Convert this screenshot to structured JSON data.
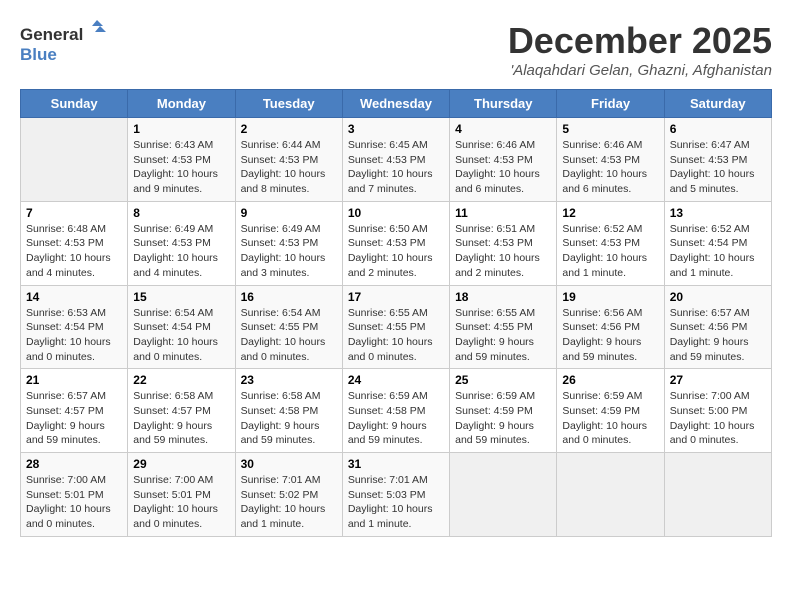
{
  "header": {
    "logo_line1": "General",
    "logo_line2": "Blue",
    "month_title": "December 2025",
    "location": "'Alaqahdari Gelan, Ghazni, Afghanistan"
  },
  "days_of_week": [
    "Sunday",
    "Monday",
    "Tuesday",
    "Wednesday",
    "Thursday",
    "Friday",
    "Saturday"
  ],
  "weeks": [
    [
      {
        "day": "",
        "info": ""
      },
      {
        "day": "1",
        "info": "Sunrise: 6:43 AM\nSunset: 4:53 PM\nDaylight: 10 hours\nand 9 minutes."
      },
      {
        "day": "2",
        "info": "Sunrise: 6:44 AM\nSunset: 4:53 PM\nDaylight: 10 hours\nand 8 minutes."
      },
      {
        "day": "3",
        "info": "Sunrise: 6:45 AM\nSunset: 4:53 PM\nDaylight: 10 hours\nand 7 minutes."
      },
      {
        "day": "4",
        "info": "Sunrise: 6:46 AM\nSunset: 4:53 PM\nDaylight: 10 hours\nand 6 minutes."
      },
      {
        "day": "5",
        "info": "Sunrise: 6:46 AM\nSunset: 4:53 PM\nDaylight: 10 hours\nand 6 minutes."
      },
      {
        "day": "6",
        "info": "Sunrise: 6:47 AM\nSunset: 4:53 PM\nDaylight: 10 hours\nand 5 minutes."
      }
    ],
    [
      {
        "day": "7",
        "info": "Sunrise: 6:48 AM\nSunset: 4:53 PM\nDaylight: 10 hours\nand 4 minutes."
      },
      {
        "day": "8",
        "info": "Sunrise: 6:49 AM\nSunset: 4:53 PM\nDaylight: 10 hours\nand 4 minutes."
      },
      {
        "day": "9",
        "info": "Sunrise: 6:49 AM\nSunset: 4:53 PM\nDaylight: 10 hours\nand 3 minutes."
      },
      {
        "day": "10",
        "info": "Sunrise: 6:50 AM\nSunset: 4:53 PM\nDaylight: 10 hours\nand 2 minutes."
      },
      {
        "day": "11",
        "info": "Sunrise: 6:51 AM\nSunset: 4:53 PM\nDaylight: 10 hours\nand 2 minutes."
      },
      {
        "day": "12",
        "info": "Sunrise: 6:52 AM\nSunset: 4:53 PM\nDaylight: 10 hours\nand 1 minute."
      },
      {
        "day": "13",
        "info": "Sunrise: 6:52 AM\nSunset: 4:54 PM\nDaylight: 10 hours\nand 1 minute."
      }
    ],
    [
      {
        "day": "14",
        "info": "Sunrise: 6:53 AM\nSunset: 4:54 PM\nDaylight: 10 hours\nand 0 minutes."
      },
      {
        "day": "15",
        "info": "Sunrise: 6:54 AM\nSunset: 4:54 PM\nDaylight: 10 hours\nand 0 minutes."
      },
      {
        "day": "16",
        "info": "Sunrise: 6:54 AM\nSunset: 4:55 PM\nDaylight: 10 hours\nand 0 minutes."
      },
      {
        "day": "17",
        "info": "Sunrise: 6:55 AM\nSunset: 4:55 PM\nDaylight: 10 hours\nand 0 minutes."
      },
      {
        "day": "18",
        "info": "Sunrise: 6:55 AM\nSunset: 4:55 PM\nDaylight: 9 hours\nand 59 minutes."
      },
      {
        "day": "19",
        "info": "Sunrise: 6:56 AM\nSunset: 4:56 PM\nDaylight: 9 hours\nand 59 minutes."
      },
      {
        "day": "20",
        "info": "Sunrise: 6:57 AM\nSunset: 4:56 PM\nDaylight: 9 hours\nand 59 minutes."
      }
    ],
    [
      {
        "day": "21",
        "info": "Sunrise: 6:57 AM\nSunset: 4:57 PM\nDaylight: 9 hours\nand 59 minutes."
      },
      {
        "day": "22",
        "info": "Sunrise: 6:58 AM\nSunset: 4:57 PM\nDaylight: 9 hours\nand 59 minutes."
      },
      {
        "day": "23",
        "info": "Sunrise: 6:58 AM\nSunset: 4:58 PM\nDaylight: 9 hours\nand 59 minutes."
      },
      {
        "day": "24",
        "info": "Sunrise: 6:59 AM\nSunset: 4:58 PM\nDaylight: 9 hours\nand 59 minutes."
      },
      {
        "day": "25",
        "info": "Sunrise: 6:59 AM\nSunset: 4:59 PM\nDaylight: 9 hours\nand 59 minutes."
      },
      {
        "day": "26",
        "info": "Sunrise: 6:59 AM\nSunset: 4:59 PM\nDaylight: 10 hours\nand 0 minutes."
      },
      {
        "day": "27",
        "info": "Sunrise: 7:00 AM\nSunset: 5:00 PM\nDaylight: 10 hours\nand 0 minutes."
      }
    ],
    [
      {
        "day": "28",
        "info": "Sunrise: 7:00 AM\nSunset: 5:01 PM\nDaylight: 10 hours\nand 0 minutes."
      },
      {
        "day": "29",
        "info": "Sunrise: 7:00 AM\nSunset: 5:01 PM\nDaylight: 10 hours\nand 0 minutes."
      },
      {
        "day": "30",
        "info": "Sunrise: 7:01 AM\nSunset: 5:02 PM\nDaylight: 10 hours\nand 1 minute."
      },
      {
        "day": "31",
        "info": "Sunrise: 7:01 AM\nSunset: 5:03 PM\nDaylight: 10 hours\nand 1 minute."
      },
      {
        "day": "",
        "info": ""
      },
      {
        "day": "",
        "info": ""
      },
      {
        "day": "",
        "info": ""
      }
    ]
  ]
}
